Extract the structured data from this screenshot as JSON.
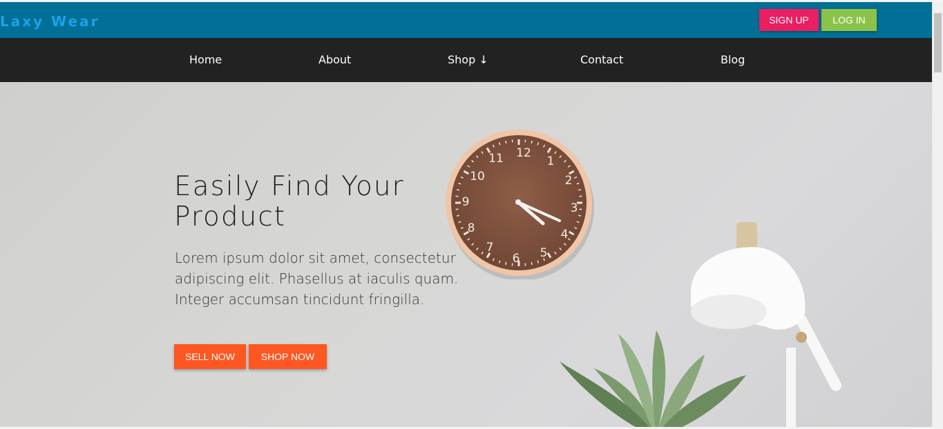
{
  "brand": {
    "name": "Laxy Wear"
  },
  "auth": {
    "signup_label": "SIGN UP",
    "login_label": "LOG IN"
  },
  "nav": {
    "items": [
      {
        "label": "Home"
      },
      {
        "label": "About"
      },
      {
        "label": "Shop ↓"
      },
      {
        "label": "Contact"
      },
      {
        "label": "Blog"
      }
    ]
  },
  "hero": {
    "title": "Easily Find Your Product",
    "text": "Lorem ipsum dolor sit amet, consectetur adipiscing elit. Phasellus at iaculis quam. Integer accumsan tincidunt fringilla.",
    "sell_label": "SELL NOW",
    "shop_label": "SHOP NOW"
  },
  "clock": {
    "numbers": [
      "12",
      "1",
      "2",
      "3",
      "4",
      "5",
      "6",
      "7",
      "8",
      "9",
      "10",
      "11"
    ]
  },
  "colors": {
    "header_bg": "#016f96",
    "brand_text": "#1aa3e8",
    "nav_bg": "#222222",
    "signup_bg": "#e91e63",
    "login_bg": "#8bc34a",
    "hero_button_bg": "#ff5722"
  }
}
